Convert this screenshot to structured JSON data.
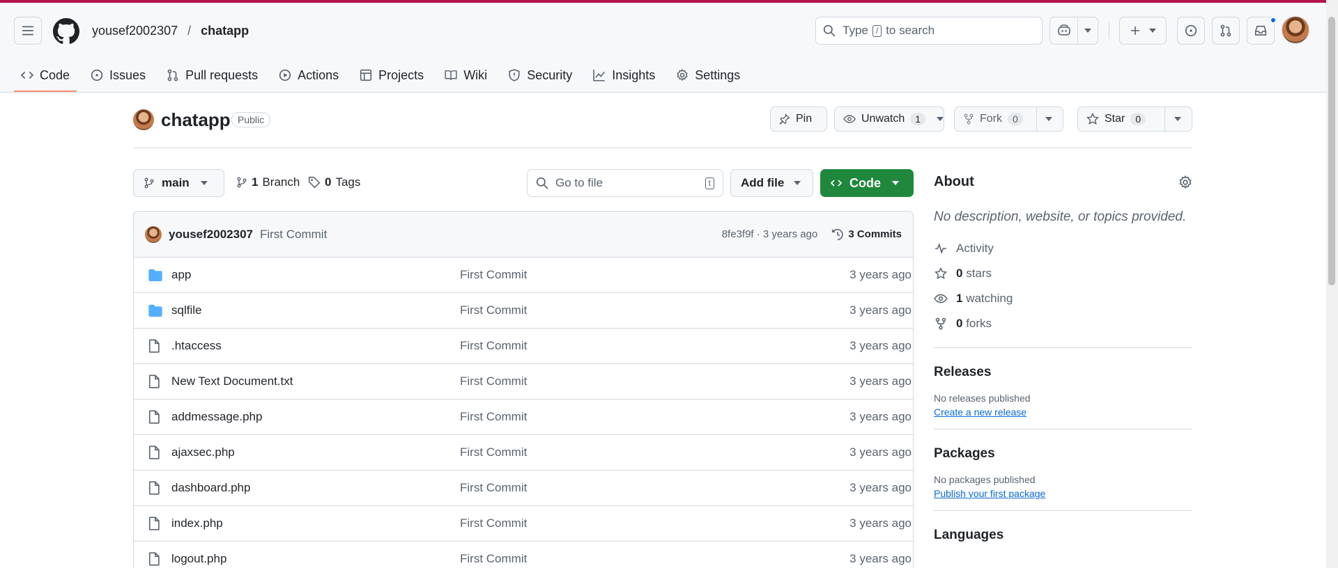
{
  "header": {
    "owner": "yousef2002307",
    "separator": "/",
    "repo": "chatapp",
    "search_text_1": "Type",
    "search_kbd": "/",
    "search_text_2": "to search"
  },
  "tabs": [
    {
      "label": "Code",
      "icon": "code-icon"
    },
    {
      "label": "Issues",
      "icon": "issue-icon"
    },
    {
      "label": "Pull requests",
      "icon": "pull-request-icon"
    },
    {
      "label": "Actions",
      "icon": "play-icon"
    },
    {
      "label": "Projects",
      "icon": "table-icon"
    },
    {
      "label": "Wiki",
      "icon": "book-icon"
    },
    {
      "label": "Security",
      "icon": "shield-icon"
    },
    {
      "label": "Insights",
      "icon": "graph-icon"
    },
    {
      "label": "Settings",
      "icon": "gear-icon"
    }
  ],
  "repo": {
    "name": "chatapp",
    "visibility": "Public",
    "pin_label": "Pin",
    "unwatch_label": "Unwatch",
    "watch_count": "1",
    "fork_label": "Fork",
    "fork_count": "0",
    "star_label": "Star",
    "star_count": "0"
  },
  "filebar": {
    "branch": "main",
    "branches_count": "1",
    "branches_label": "Branch",
    "tags_count": "0",
    "tags_label": "Tags",
    "goto_placeholder": "Go to file",
    "goto_kbd": "t",
    "add_file_label": "Add file",
    "code_label": "Code"
  },
  "commit": {
    "author": "yousef2002307",
    "message": "First Commit",
    "hash_time": "8fe3f9f · 3 years ago",
    "commits_label": "3 Commits"
  },
  "files": [
    {
      "name": "app",
      "type": "folder",
      "message": "First Commit",
      "date": "3 years ago"
    },
    {
      "name": "sqlfile",
      "type": "folder",
      "message": "First Commit",
      "date": "3 years ago"
    },
    {
      "name": ".htaccess",
      "type": "file",
      "message": "First Commit",
      "date": "3 years ago"
    },
    {
      "name": "New Text Document.txt",
      "type": "file",
      "message": "First Commit",
      "date": "3 years ago"
    },
    {
      "name": "addmessage.php",
      "type": "file",
      "message": "First Commit",
      "date": "3 years ago"
    },
    {
      "name": "ajaxsec.php",
      "type": "file",
      "message": "First Commit",
      "date": "3 years ago"
    },
    {
      "name": "dashboard.php",
      "type": "file",
      "message": "First Commit",
      "date": "3 years ago"
    },
    {
      "name": "index.php",
      "type": "file",
      "message": "First Commit",
      "date": "3 years ago"
    },
    {
      "name": "logout.php",
      "type": "file",
      "message": "First Commit",
      "date": "3 years ago"
    }
  ],
  "about": {
    "title": "About",
    "description": "No description, website, or topics provided.",
    "activity_label": "Activity",
    "stars_count": "0",
    "stars_label": "stars",
    "watching_count": "1",
    "watching_label": "watching",
    "forks_count": "0",
    "forks_label": "forks"
  },
  "releases": {
    "title": "Releases",
    "empty_text": "No releases published",
    "link": "Create a new release"
  },
  "packages": {
    "title": "Packages",
    "empty_text": "No packages published",
    "link": "Publish your first package"
  },
  "languages": {
    "title": "Languages"
  },
  "colors": {
    "accent_green": "#1f883d",
    "link_blue": "#0969da",
    "tab_underline": "#fd8c73",
    "folder_blue": "#54aeff",
    "top_stripe": "#b4154a"
  }
}
